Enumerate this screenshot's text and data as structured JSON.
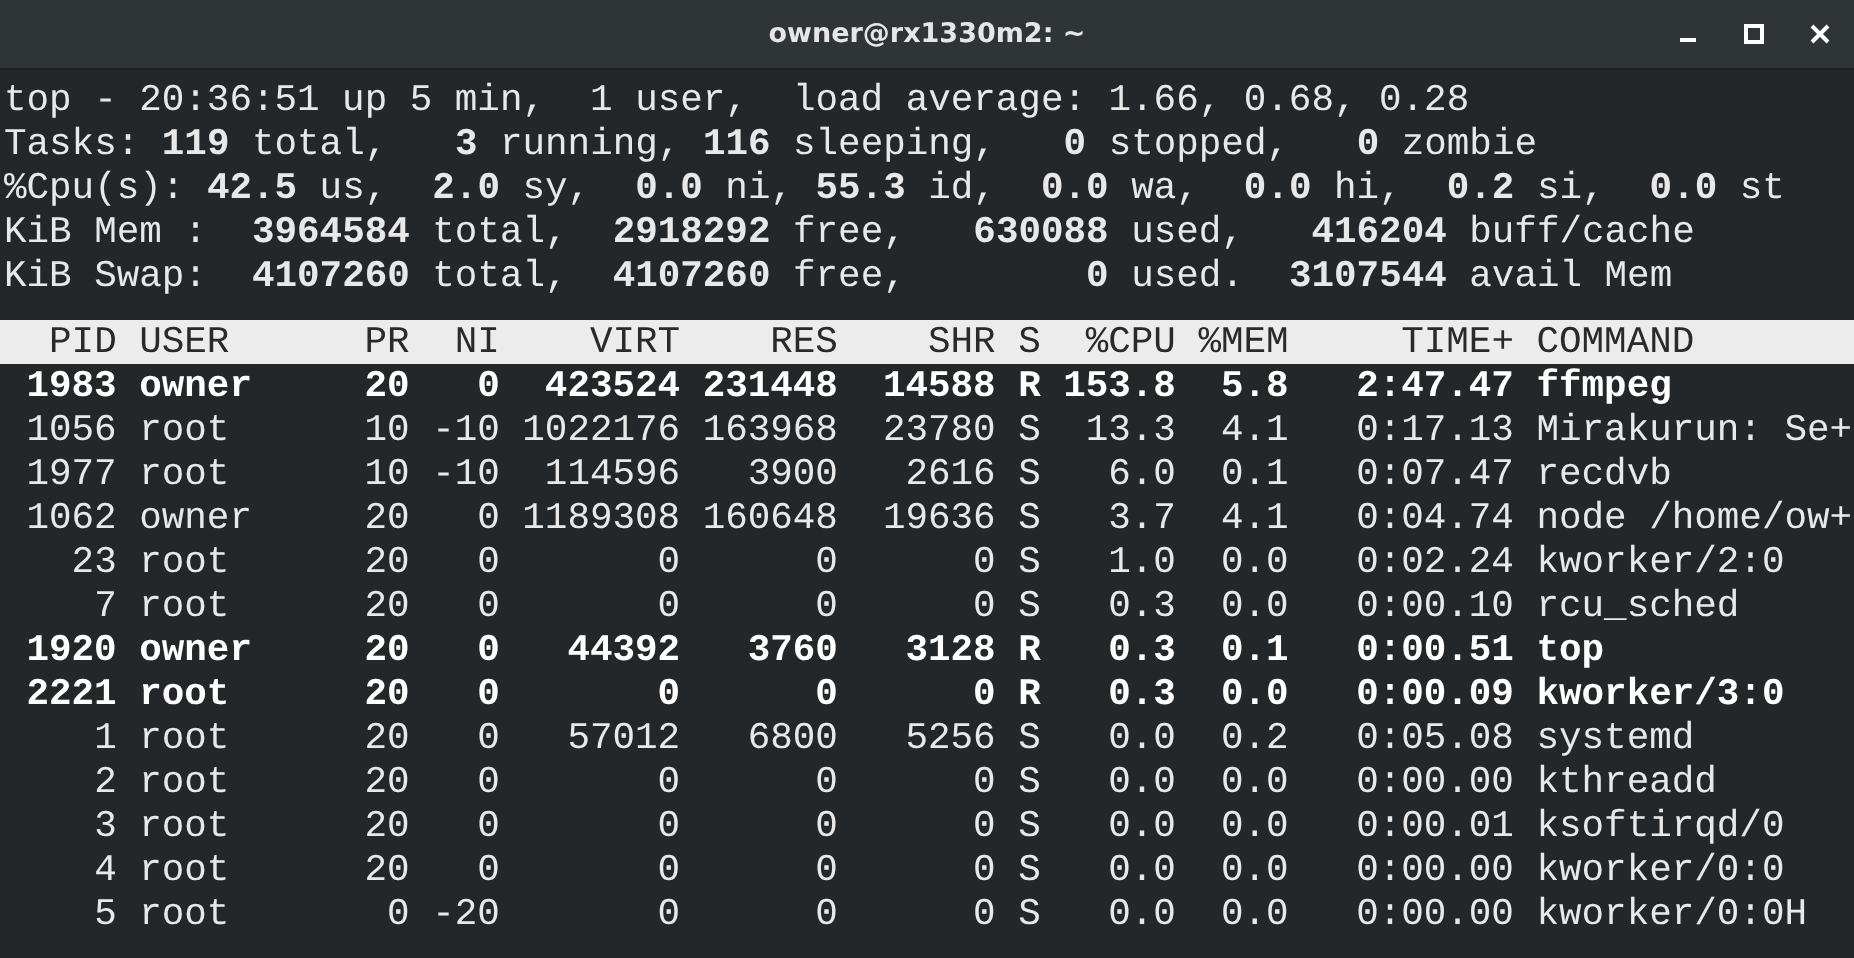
{
  "window": {
    "title": "owner@rx1330m2: ~"
  },
  "summary": [
    "top - 20:36:51 up 5 min,  1 user,  load average: 1.66, 0.68, 0.28",
    "Tasks: **119** total,   **3** running, **116** sleeping,   **0** stopped,   **0** zombie",
    "%Cpu(s): **42.5** us,  **2.0** sy,  **0.0** ni, **55.3** id,  **0.0** wa,  **0.0** hi,  **0.2** si,  **0.0** st",
    "KiB Mem :  **3964584** total,  **2918292** free,   **630088** used,   **416204** buff/cache",
    "KiB Swap:  **4107260** total,  **4107260** free,        **0** used.  **3107544** avail Mem"
  ],
  "table": {
    "columns": [
      "PID",
      "USER",
      "PR",
      "NI",
      "VIRT",
      "RES",
      "SHR",
      "S",
      "%CPU",
      "%MEM",
      "TIME+",
      "COMMAND"
    ],
    "rows": [
      {
        "highlighted": true,
        "cells": [
          "1983",
          "owner",
          "20",
          "0",
          "423524",
          "231448",
          "14588",
          "R",
          "153.8",
          "5.8",
          "2:47.47",
          "ffmpeg"
        ]
      },
      {
        "highlighted": false,
        "cells": [
          "1056",
          "root",
          "10",
          "-10",
          "1022176",
          "163968",
          "23780",
          "S",
          "13.3",
          "4.1",
          "0:17.13",
          "Mirakurun: Se+"
        ]
      },
      {
        "highlighted": false,
        "cells": [
          "1977",
          "root",
          "10",
          "-10",
          "114596",
          "3900",
          "2616",
          "S",
          "6.0",
          "0.1",
          "0:07.47",
          "recdvb"
        ]
      },
      {
        "highlighted": false,
        "cells": [
          "1062",
          "owner",
          "20",
          "0",
          "1189308",
          "160648",
          "19636",
          "S",
          "3.7",
          "4.1",
          "0:04.74",
          "node /home/ow+"
        ]
      },
      {
        "highlighted": false,
        "cells": [
          "23",
          "root",
          "20",
          "0",
          "0",
          "0",
          "0",
          "S",
          "1.0",
          "0.0",
          "0:02.24",
          "kworker/2:0"
        ]
      },
      {
        "highlighted": false,
        "cells": [
          "7",
          "root",
          "20",
          "0",
          "0",
          "0",
          "0",
          "S",
          "0.3",
          "0.0",
          "0:00.10",
          "rcu_sched"
        ]
      },
      {
        "highlighted": true,
        "cells": [
          "1920",
          "owner",
          "20",
          "0",
          "44392",
          "3760",
          "3128",
          "R",
          "0.3",
          "0.1",
          "0:00.51",
          "top"
        ]
      },
      {
        "highlighted": true,
        "cells": [
          "2221",
          "root",
          "20",
          "0",
          "0",
          "0",
          "0",
          "R",
          "0.3",
          "0.0",
          "0:00.09",
          "kworker/3:0"
        ]
      },
      {
        "highlighted": false,
        "cells": [
          "1",
          "root",
          "20",
          "0",
          "57012",
          "6800",
          "5256",
          "S",
          "0.0",
          "0.2",
          "0:05.08",
          "systemd"
        ]
      },
      {
        "highlighted": false,
        "cells": [
          "2",
          "root",
          "20",
          "0",
          "0",
          "0",
          "0",
          "S",
          "0.0",
          "0.0",
          "0:00.00",
          "kthreadd"
        ]
      },
      {
        "highlighted": false,
        "cells": [
          "3",
          "root",
          "20",
          "0",
          "0",
          "0",
          "0",
          "S",
          "0.0",
          "0.0",
          "0:00.01",
          "ksoftirqd/0"
        ]
      },
      {
        "highlighted": false,
        "cells": [
          "4",
          "root",
          "20",
          "0",
          "0",
          "0",
          "0",
          "S",
          "0.0",
          "0.0",
          "0:00.00",
          "kworker/0:0"
        ]
      },
      {
        "highlighted": false,
        "cells": [
          "5",
          "root",
          "0",
          "-20",
          "0",
          "0",
          "0",
          "S",
          "0.0",
          "0.0",
          "0:00.00",
          "kworker/0:0H"
        ]
      }
    ]
  }
}
